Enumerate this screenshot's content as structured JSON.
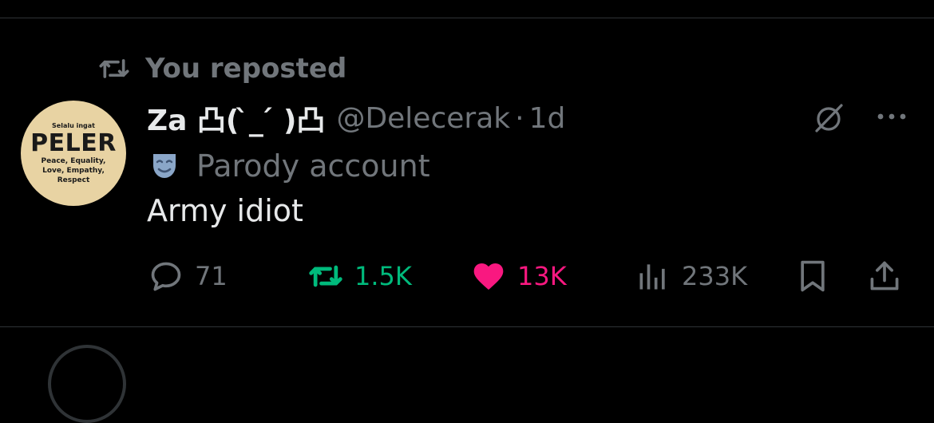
{
  "repost_banner": {
    "text": "You reposted",
    "icon": "repost-icon"
  },
  "author": {
    "avatar": {
      "top_text": "Selalu ingat",
      "main_text": "PELER",
      "tagline": "Peace, Equality, Love, Empathy, Respect"
    },
    "display_name": "Za 凸( ̀_ ́ )凸",
    "handle": "@Delecerak",
    "separator": "·",
    "time": "1d"
  },
  "badge": {
    "text": "Parody account",
    "icon": "theater-mask-icon"
  },
  "post": {
    "text": "Army idiot"
  },
  "stats": {
    "replies": "71",
    "reposts": "1.5K",
    "likes": "13K",
    "views": "233K"
  },
  "colors": {
    "background": "#000000",
    "text": "#e7e9ea",
    "muted": "#71767b",
    "repost_active": "#00ba7c",
    "like_active": "#f91880"
  }
}
